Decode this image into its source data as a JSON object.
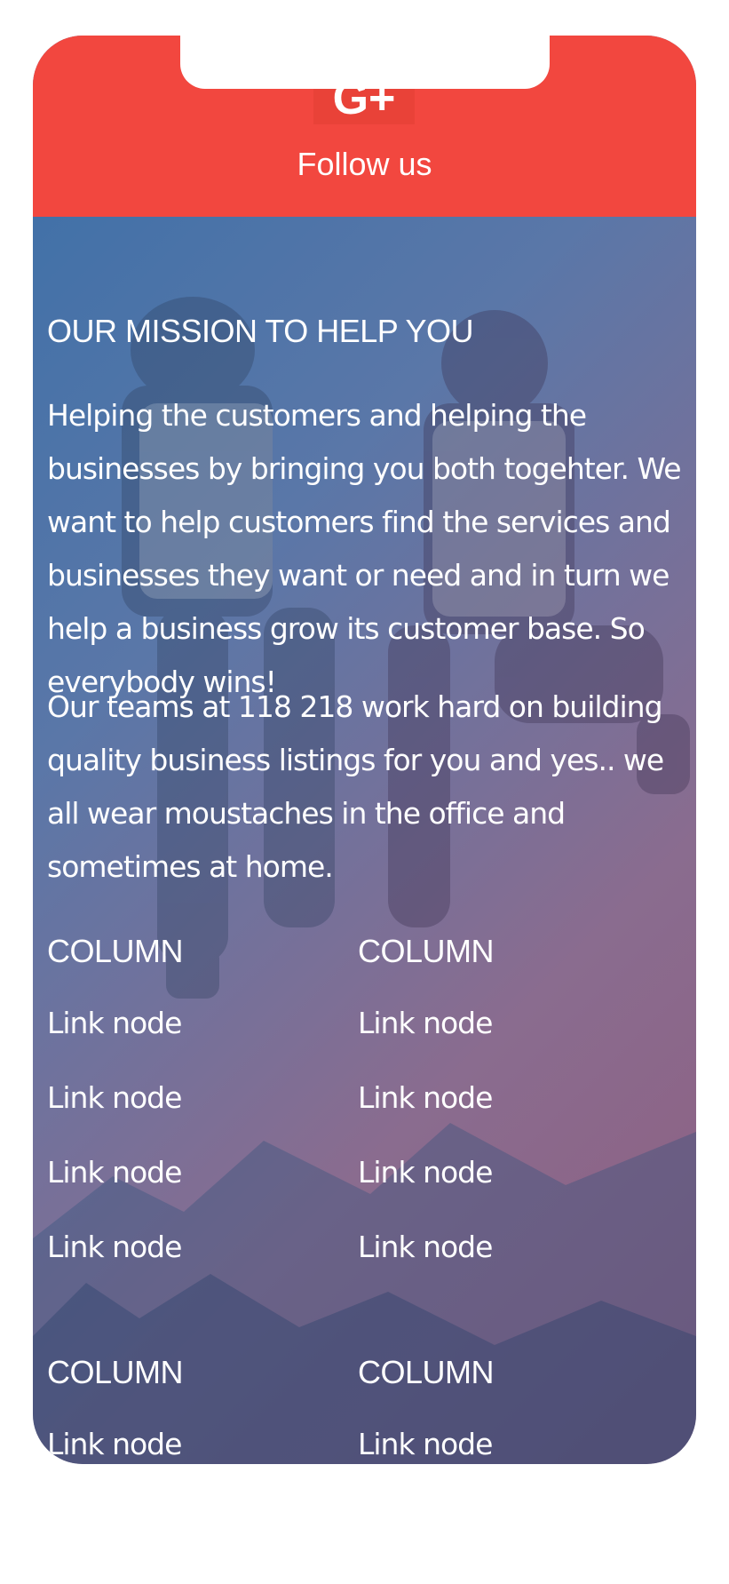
{
  "header": {
    "social_icon": "google-plus-icon",
    "icon_glyph": "G+",
    "follow_label": "Follow us",
    "background": "#f2473f"
  },
  "mission": {
    "title": "OUR MISSION TO HELP YOU",
    "paragraph_1": "Helping the customers and helping the businesses by bringing you both togehter. We want to help customers find the services and businesses they want or need and in turn we help a business grow its customer base. So everybody wins!",
    "paragraph_2": "Our teams at 118 218 work hard on building quality business listings for you and yes.. we all wear moustaches in the office and sometimes at home."
  },
  "columns": [
    {
      "heading": "COLUMN",
      "links": [
        "Link node",
        "Link node",
        "Link node",
        "Link node"
      ]
    },
    {
      "heading": "COLUMN",
      "links": [
        "Link node",
        "Link node",
        "Link node",
        "Link node"
      ]
    },
    {
      "heading": "COLUMN",
      "links": [
        "Link node"
      ]
    },
    {
      "heading": "COLUMN",
      "links": [
        "Link node"
      ]
    }
  ],
  "colors": {
    "gradient_start": "#3a6fa8",
    "gradient_end": "#8e5d7f",
    "text": "#ffffff"
  }
}
